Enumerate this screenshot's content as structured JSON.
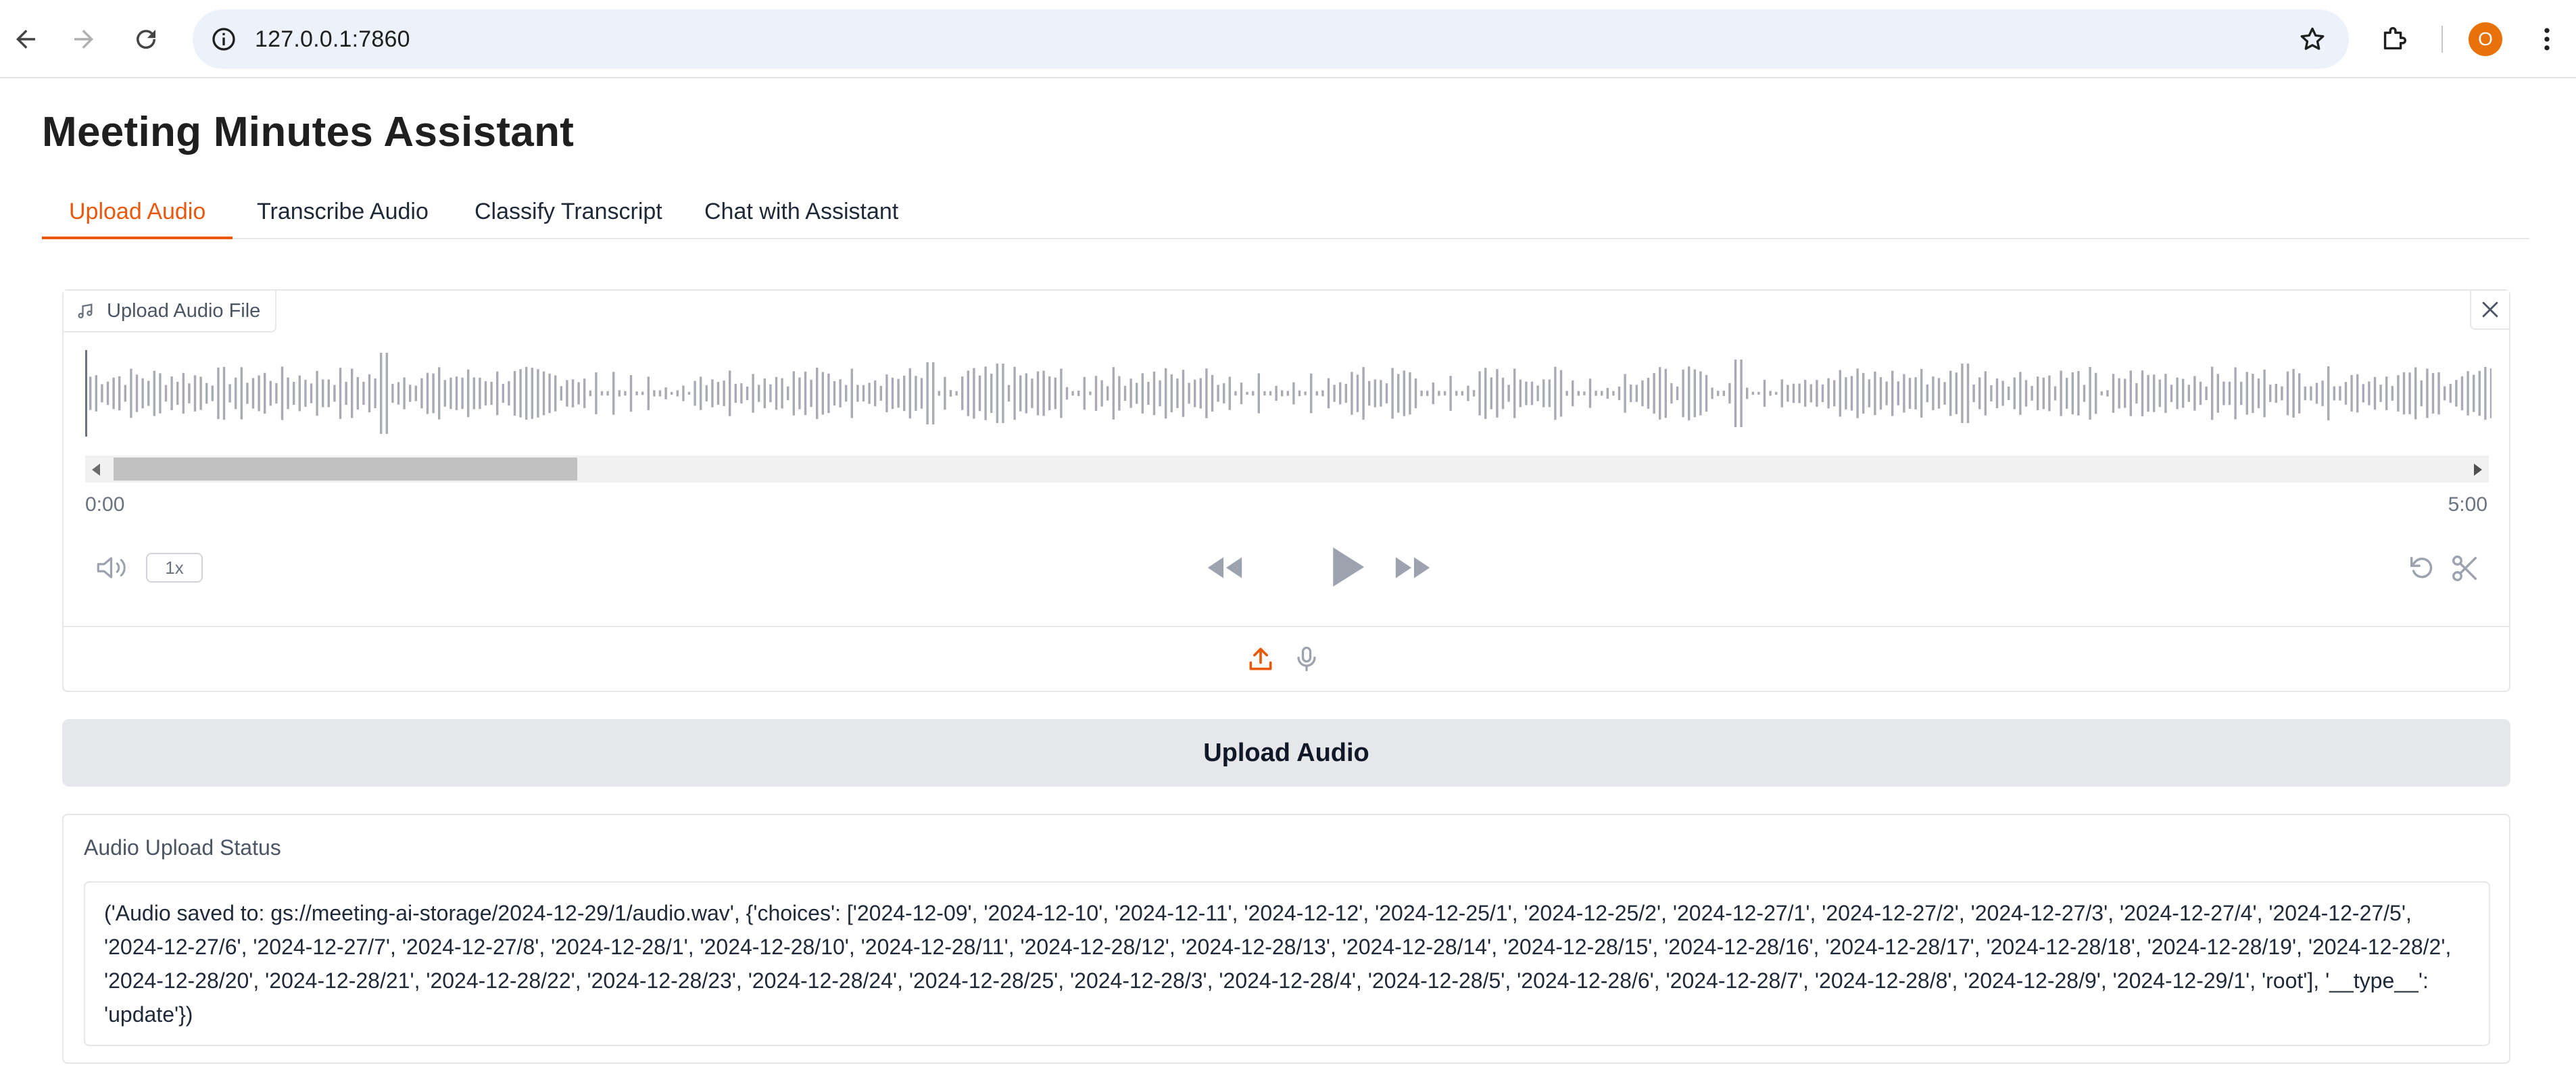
{
  "browser": {
    "url": "127.0.0.1:7860",
    "profile_initial": "O",
    "colors": {
      "omnibox": "#edf2fa",
      "avatar": "#e8710a"
    }
  },
  "app": {
    "title": "Meeting Minutes Assistant",
    "accent_color": "#ea580c",
    "tabs": [
      {
        "label": "Upload Audio",
        "active": true
      },
      {
        "label": "Transcribe Audio",
        "active": false
      },
      {
        "label": "Classify Transcript",
        "active": false
      },
      {
        "label": "Chat with Assistant",
        "active": false
      }
    ]
  },
  "audio": {
    "label": "Upload Audio File",
    "label_icon": "music-note-icon",
    "time_start": "0:00",
    "time_end": "5:00",
    "playback_rate": "1x",
    "source_selected": "upload",
    "icons": [
      "volume-icon",
      "rewind-icon",
      "play-icon",
      "fast-forward-icon",
      "undo-icon",
      "scissors-icon",
      "upload-icon",
      "microphone-icon",
      "close-icon"
    ]
  },
  "upload_button_label": "Upload Audio",
  "status": {
    "label": "Audio Upload Status",
    "text": "('Audio saved to: gs://meeting-ai-storage/2024-12-29/1/audio.wav', {'choices': ['2024-12-09', '2024-12-10', '2024-12-11', '2024-12-12', '2024-12-25/1', '2024-12-25/2', '2024-12-27/1', '2024-12-27/2', '2024-12-27/3', '2024-12-27/4', '2024-12-27/5', '2024-12-27/6', '2024-12-27/7', '2024-12-27/8', '2024-12-28/1', '2024-12-28/10', '2024-12-28/11', '2024-12-28/12', '2024-12-28/13', '2024-12-28/14', '2024-12-28/15', '2024-12-28/16', '2024-12-28/17', '2024-12-28/18', '2024-12-28/19', '2024-12-28/2', '2024-12-28/20', '2024-12-28/21', '2024-12-28/22', '2024-12-28/23', '2024-12-28/24', '2024-12-28/25', '2024-12-28/3', '2024-12-28/4', '2024-12-28/5', '2024-12-28/6', '2024-12-28/7', '2024-12-28/8', '2024-12-28/9', '2024-12-29/1', 'root'], '__type__': 'update'})"
  }
}
